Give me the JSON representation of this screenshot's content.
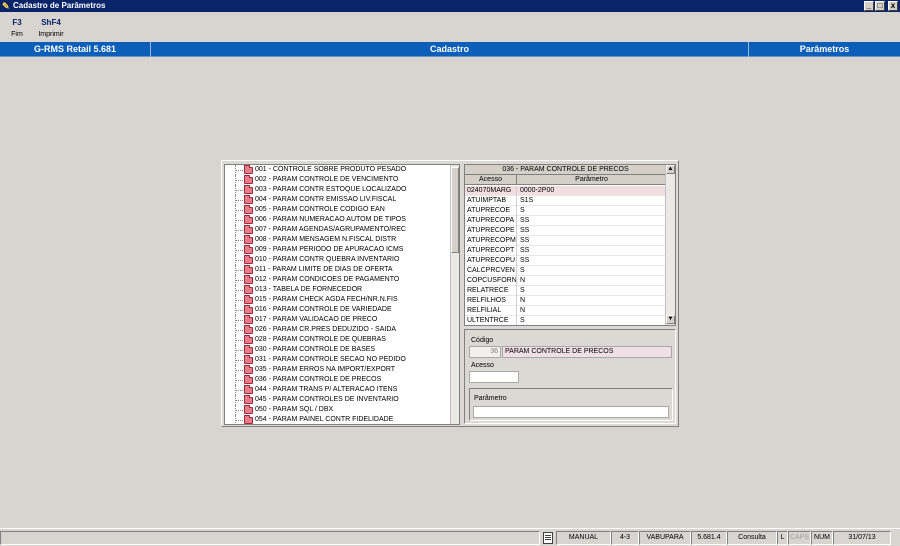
{
  "window": {
    "title": "Cadastro de Parâmetros",
    "icon": "pencil-icon",
    "buttons": [
      "_",
      "□",
      "x"
    ]
  },
  "toolbar": {
    "items": [
      {
        "key": "F3",
        "label": "Fim"
      },
      {
        "key": "ShF4",
        "label": "Imprimir"
      }
    ]
  },
  "header": {
    "left": "G-RMS Retail 5.681",
    "center": "Cadastro",
    "right": "Parâmetros"
  },
  "tree": {
    "items": [
      "001 - CONTROLE SOBRE PRODUTO PESADO",
      "002 - PARAM CONTROLE DE VENCIMENTO",
      "003 - PARAM CONTR ESTOQUE LOCALIZADO",
      "004 - PARAM CONTR EMISSAO LIV.FISCAL",
      "005 - PARAM CONTROLE CODIGO EAN",
      "006 - PARAM NUMERACAO AUTOM DE TIPOS",
      "007 - PARAM AGENDAS/AGRUPAMENTO/REC",
      "008 - PARAM MENSAGEM N.FISCAL DISTR",
      "009 - PARAM PERIODO DE APURACAO ICMS",
      "010 - PARAM CONTR QUEBRA INVENTARIO",
      "011 - PARAM LIMITE DE DIAS DE OFERTA",
      "012 - PARAM CONDICOES DE PAGAMENTO",
      "013 - TABELA DE FORNECEDOR",
      "015 - PARAM CHECK AGDA FECH/NR.N.FIS",
      "016 - PARAM CONTROLE DE VARIEDADE",
      "017 - PARAM VALIDACAO DE PRECO",
      "026 - PARAM CR.PRES DEDUZIDO - SAIDA",
      "028 - PARAM CONTROLE DE QUEBRAS",
      "030 - PARAM CONTROLE DE BASES",
      "031 - PARAM CONTROLE SECAO NO PEDIDO",
      "035 - PARAM ERROS NA IMPORT/EXPORT",
      "036 - PARAM CONTROLE DE PRECOS",
      "044 - PARAM TRANS P/ ALTERACAO ITENS",
      "045 - PARAM CONTROLES DE INVENTARIO",
      "050 - PARAM SQL / DBX",
      "054 - PARAM PAINEL CONTR FIDELIDADE"
    ]
  },
  "grid": {
    "caption": "036 - PARAM CONTROLE DE PRECOS",
    "columns": [
      "Acesso",
      "Parâmetro"
    ],
    "rows": [
      {
        "acesso": "024070MARG",
        "parametro": "0000-2P00"
      },
      {
        "acesso": "ATUIMPTAB",
        "parametro": "S1S"
      },
      {
        "acesso": "ATUPRECOE",
        "parametro": "S"
      },
      {
        "acesso": "ATUPRECOPA",
        "parametro": "SS"
      },
      {
        "acesso": "ATUPRECOPE",
        "parametro": "SS"
      },
      {
        "acesso": "ATUPRECOPM",
        "parametro": "SS"
      },
      {
        "acesso": "ATUPRECOPT",
        "parametro": "SS"
      },
      {
        "acesso": "ATUPRECOPU",
        "parametro": "SS"
      },
      {
        "acesso": "CALCPRCVEN",
        "parametro": "S"
      },
      {
        "acesso": "COPCUSFORN",
        "parametro": "N"
      },
      {
        "acesso": "RELATRECE",
        "parametro": "S"
      },
      {
        "acesso": "RELFILHOS",
        "parametro": "N"
      },
      {
        "acesso": "RELFILIAL",
        "parametro": "N"
      },
      {
        "acesso": "ULTENTRCE",
        "parametro": "S"
      }
    ]
  },
  "form": {
    "codigo_label": "Código",
    "codigo_value": "36",
    "codigo_desc": "PARAM CONTROLE DE PRECOS",
    "acesso_label": "Acesso",
    "acesso_value": "",
    "parametro_label": "Parâmetro",
    "parametro_value": ""
  },
  "status": {
    "mode": "MANUAL",
    "version_code": "4-3",
    "user": "VABUPARA",
    "version": "5.681.4",
    "operation": "Consulta",
    "l": "L",
    "caps": "CAPS",
    "num": "NUM",
    "date": "31/07/13"
  }
}
